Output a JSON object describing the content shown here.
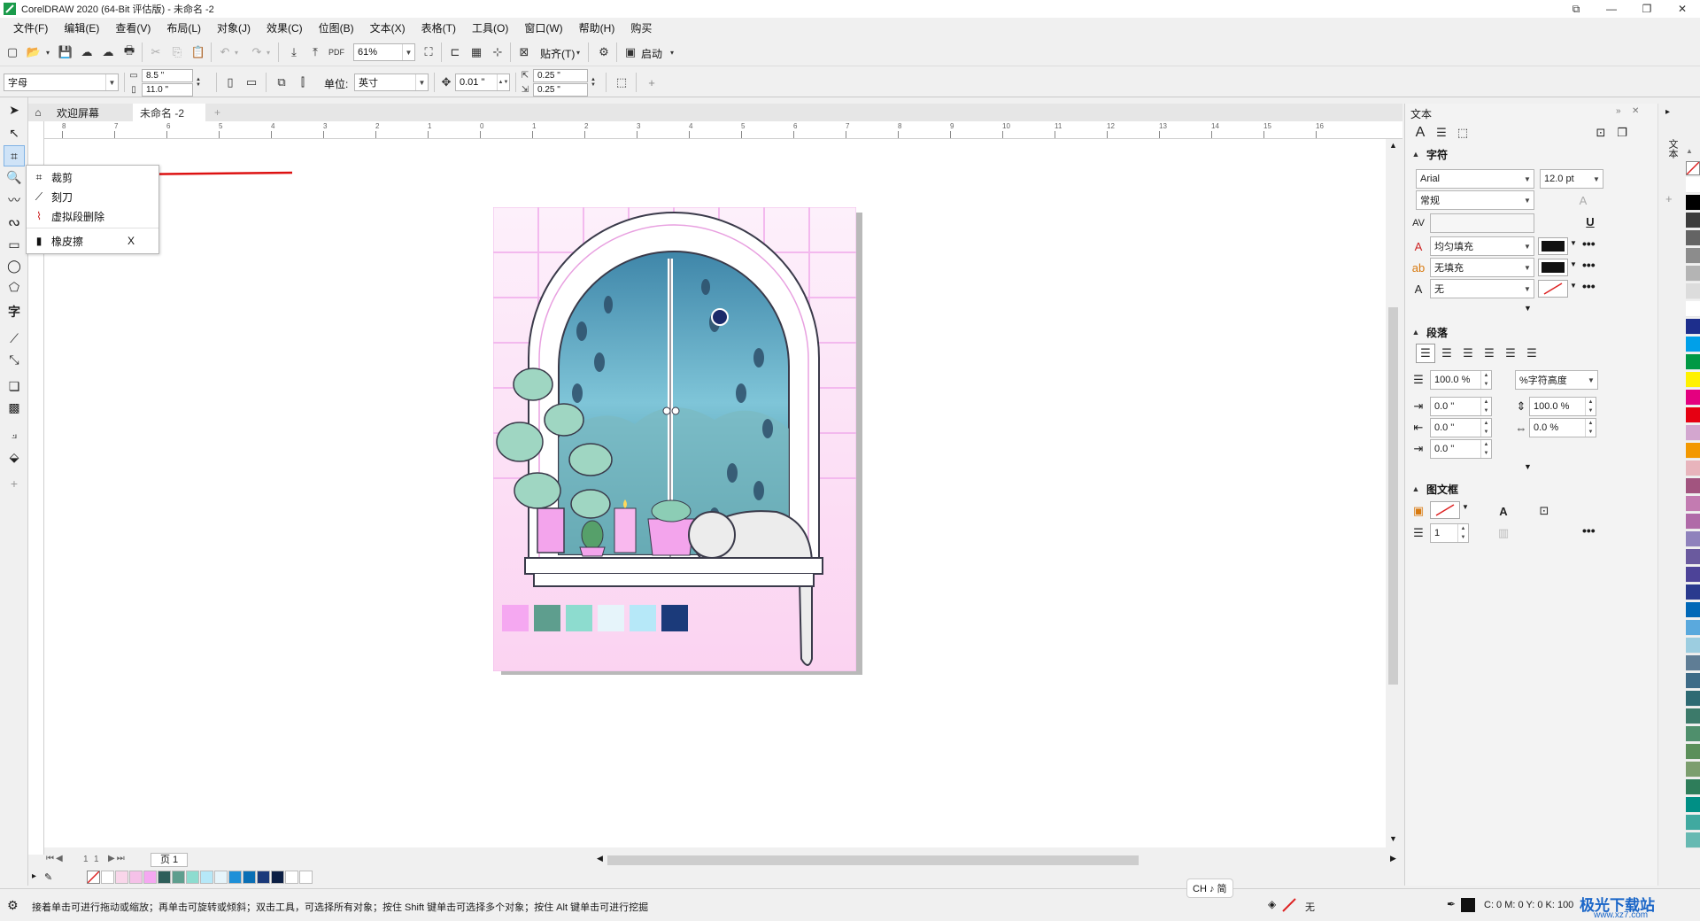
{
  "window": {
    "title": "CorelDRAW 2020 (64-Bit 评估版) - 未命名 -2"
  },
  "menubar": [
    {
      "label": "文件(F)"
    },
    {
      "label": "编辑(E)"
    },
    {
      "label": "查看(V)"
    },
    {
      "label": "布局(L)"
    },
    {
      "label": "对象(J)"
    },
    {
      "label": "效果(C)"
    },
    {
      "label": "位图(B)"
    },
    {
      "label": "文本(X)"
    },
    {
      "label": "表格(T)"
    },
    {
      "label": "工具(O)"
    },
    {
      "label": "窗口(W)"
    },
    {
      "label": "帮助(H)"
    },
    {
      "label": "购买"
    }
  ],
  "stdbar": {
    "zoom": "61%",
    "snap_label": "贴齐(T)",
    "launch_label": "启动"
  },
  "propbar": {
    "preset": "字母",
    "width": "8.5 \"",
    "height": "11.0 \"",
    "units_label": "单位:",
    "units": "英寸",
    "nudge": "0.01 \"",
    "dup_x": "0.25 \"",
    "dup_y": "0.25 \""
  },
  "doctabs": {
    "home": "欢迎屏幕",
    "doc": "未命名 -2",
    "add": "+"
  },
  "flyout": {
    "items": [
      {
        "label": "裁剪",
        "shortcut": ""
      },
      {
        "label": "刻刀",
        "shortcut": ""
      },
      {
        "label": "虚拟段删除",
        "shortcut": ""
      },
      {
        "label": "橡皮擦",
        "shortcut": "X"
      }
    ]
  },
  "ruler": {
    "h_ticks": [
      "8",
      "7",
      "6",
      "5",
      "4",
      "3",
      "2",
      "1",
      "0",
      "1",
      "2",
      "3",
      "4",
      "5",
      "6",
      "7",
      "8",
      "9",
      "10",
      "11",
      "12",
      "13",
      "14",
      "15",
      "16"
    ]
  },
  "artwork": {
    "swatches": [
      "#f5a8f1",
      "#5e9e8e",
      "#8ddccf",
      "#e6f4fa",
      "#b6e8f8",
      "#1b3a7a"
    ]
  },
  "pagenav": {
    "current": "1",
    "of": "1",
    "page_tab": "页 1"
  },
  "doc_palette": [
    "#ffffff",
    "#f9d6ea",
    "#f5c1e8",
    "#f5a8f1",
    "#2e5e5a",
    "#5e9e8e",
    "#8ddccf",
    "#b6e8f8",
    "#e6f4fa",
    "#1e90d8",
    "#0a6fb5",
    "#1b3a7a",
    "#0c1f44",
    "#ffffff",
    "#ffffff"
  ],
  "docker": {
    "title": "文本",
    "char_section": "字符",
    "font": "Arial",
    "font_size": "12.0 pt",
    "font_style": "常规",
    "fill1": "均匀填充",
    "fill2": "无填充",
    "fill3": "无",
    "para_section": "段落",
    "line_spacing": "100.0 %",
    "line_spacing_unit": "%字符高度",
    "indent1": "0.0 \"",
    "indent2": "0.0 \"",
    "indent3": "0.0 \"",
    "char_spacing": "100.0 %",
    "word_spacing": "0.0 %",
    "frame_section": "图文框",
    "columns": "1"
  },
  "right_palette": [
    "#ffffff",
    "#000000",
    "#3c3c3c",
    "#646464",
    "#8c8c8c",
    "#b4b4b4",
    "#dcdcdc",
    "#ffffff",
    "#1d2e8c",
    "#00a0e9",
    "#009944",
    "#fff100",
    "#e4007f",
    "#e60012",
    "#d3a6cf",
    "#f39800",
    "#e8b4bc",
    "#a2547f",
    "#c37bb1",
    "#b06aa8",
    "#8f82bc",
    "#6a5a9e",
    "#4d4398",
    "#2a3a8e",
    "#0068b7",
    "#5aa9dd",
    "#9ccde0",
    "#5f7d95",
    "#3e6b87",
    "#2e6a73",
    "#3c7a6a",
    "#4f8f6c",
    "#5b8f5a",
    "#7c9e6e",
    "#2e7d5a",
    "#008f85",
    "#40a9a0",
    "#66b9b2"
  ],
  "statusbar": {
    "hint": "接着单击可进行拖动或缩放；再单击可旋转或倾斜；双击工具，可选择所有对象；按住 Shift 键单击可选择多个对象；按住 Alt 键单击可进行挖掘",
    "ime": "CH ♪ 简",
    "fill_none": "无",
    "cmyk": "C: 0 M: 0 Y: 0 K: 100"
  },
  "watermark": {
    "text": "极光下载站",
    "url": "www.xz7.com"
  }
}
